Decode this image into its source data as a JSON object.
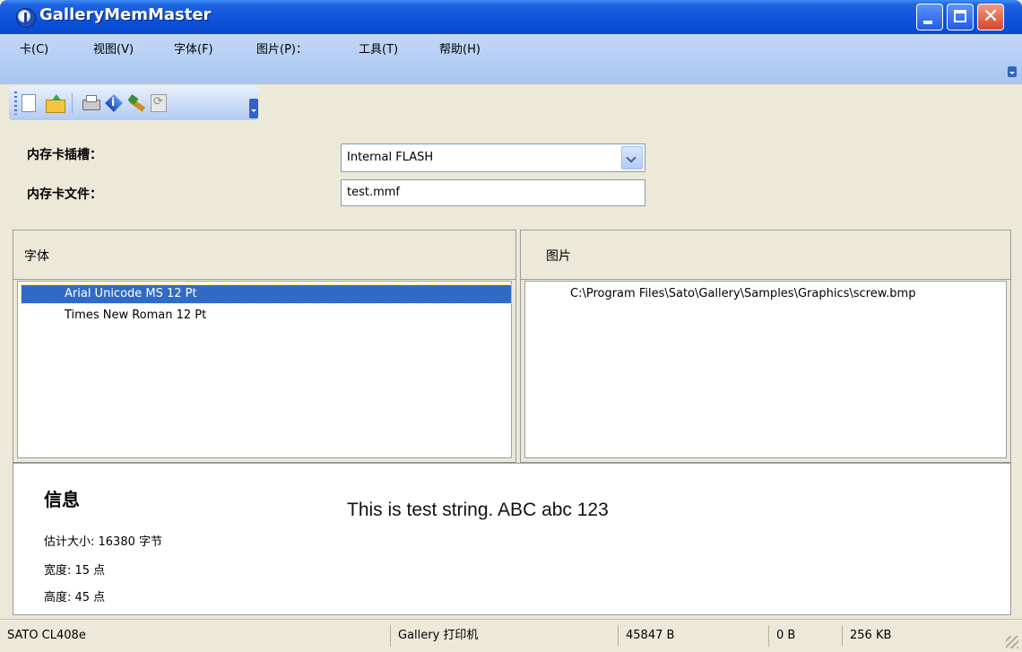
{
  "window": {
    "title": "GalleryMemMaster"
  },
  "menu": {
    "items": [
      {
        "label": "卡(C)"
      },
      {
        "label": "视图(V)"
      },
      {
        "label": "字体(F)"
      },
      {
        "label": "图片(P)："
      },
      {
        "label": "工具(T)"
      },
      {
        "label": "帮助(H)"
      }
    ]
  },
  "toolbar": {
    "icons": [
      "new-file-icon",
      "open-folder-icon",
      "print-icon",
      "info-icon",
      "erase-icon",
      "refresh-icon"
    ]
  },
  "settings": {
    "slot_label": "内存卡插槽：",
    "slot_value": "Internal FLASH",
    "file_label": "内存卡文件：",
    "file_value": "test.mmf"
  },
  "fonts_panel": {
    "title": "字体",
    "items": [
      {
        "label": "Arial Unicode MS 12 Pt",
        "selected": true
      },
      {
        "label": "Times New Roman 12 Pt",
        "selected": false
      }
    ]
  },
  "pictures_panel": {
    "title": "图片",
    "items": [
      {
        "label": "C:\\Program Files\\Sato\\Gallery\\Samples\\Graphics\\screw.bmp"
      }
    ]
  },
  "info": {
    "title": "信息",
    "preview_text": "This is test string. ABC abc 123",
    "size_line": "估计大小: 16380 字节",
    "width_line": "宽度: 15 点",
    "height_line": "高度: 45 点"
  },
  "status": {
    "printer": "SATO CL408e",
    "mode": "Gallery 打印机",
    "used": "45847 B",
    "free": "0 B",
    "total": "256 KB"
  }
}
